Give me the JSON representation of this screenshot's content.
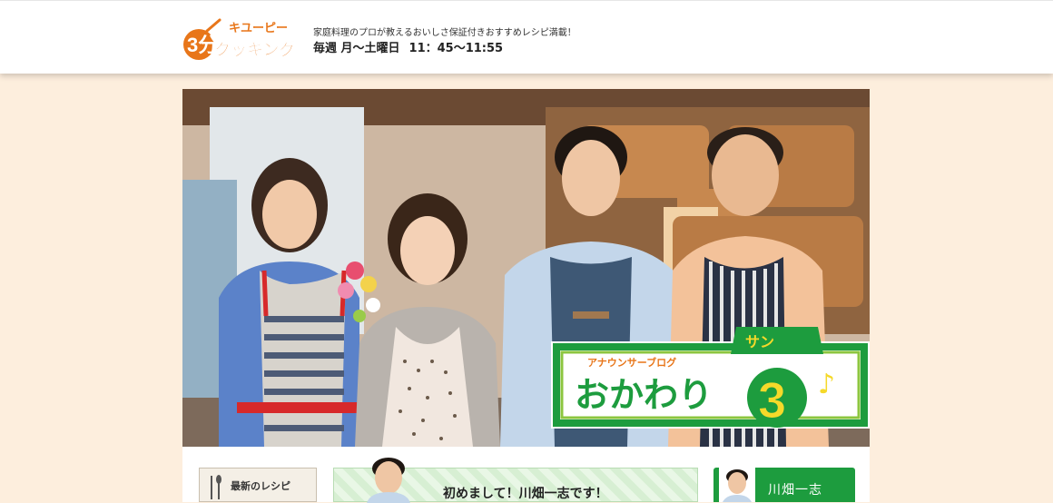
{
  "header": {
    "logo_alt": "キユーピー 3分クッキング",
    "tagline": "家庭料理のプロが教えるおいしさ保証付きおすすめレシピ満載！",
    "schedule_days": "毎週 月〜土曜日",
    "schedule_time": "11：45〜11:55"
  },
  "hero": {
    "badge_small": "アナウンサーブログ",
    "badge_main": "おかわり",
    "badge_number": "3",
    "badge_reading": "サン",
    "badge_note": "♪"
  },
  "content": {
    "latest_recipes_label": "最新のレシピ",
    "blog_post_title": "初めまして！川畑一志です！",
    "profile_name": "川畑一志"
  },
  "colors": {
    "accent_orange": "#e8761a",
    "accent_green": "#1d9c3e",
    "badge_yellow": "#f5d92a",
    "page_bg": "#fdeedd"
  }
}
